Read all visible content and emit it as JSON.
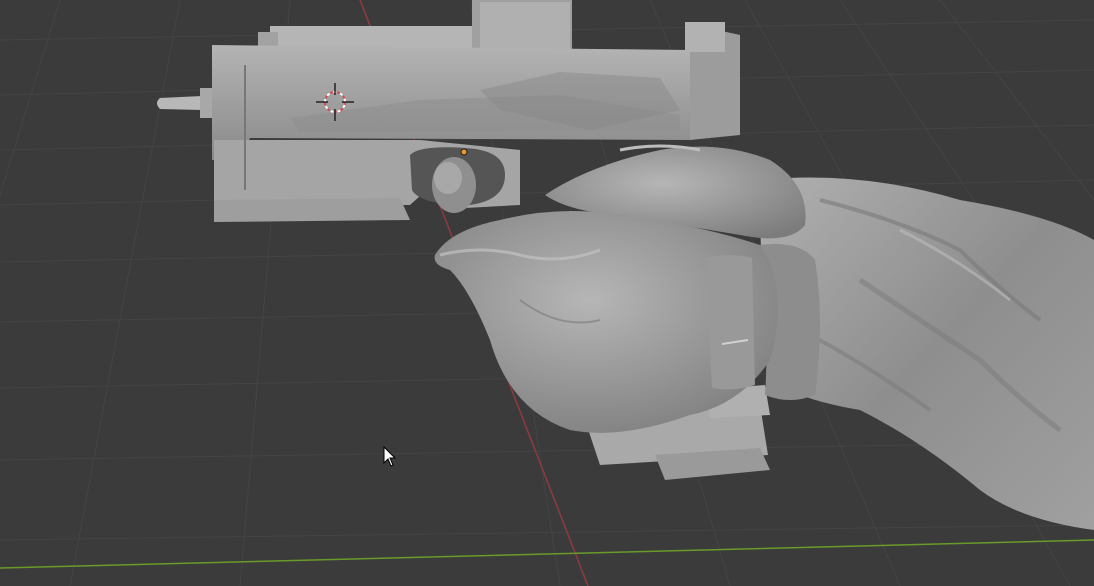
{
  "viewport": {
    "background": "#3b3b3b",
    "grid_color": "#444444",
    "axis_x_color": "#8f3a3f",
    "axis_y_color": "#6a9a2a",
    "mesh_base_color": "#a6a6a6",
    "mesh_shadow_color": "#7e7e7e",
    "origin_marker_color": "#e89a2b",
    "3d_cursor_colors": [
      "#d94a4a",
      "#ffffff"
    ]
  },
  "scene": {
    "objects": [
      "pistol-mesh",
      "gloved-hand-mesh",
      "sleeve-mesh"
    ],
    "selected_origin": "origin-point"
  },
  "cursor": {
    "icon": "arrow-pointer-icon"
  }
}
